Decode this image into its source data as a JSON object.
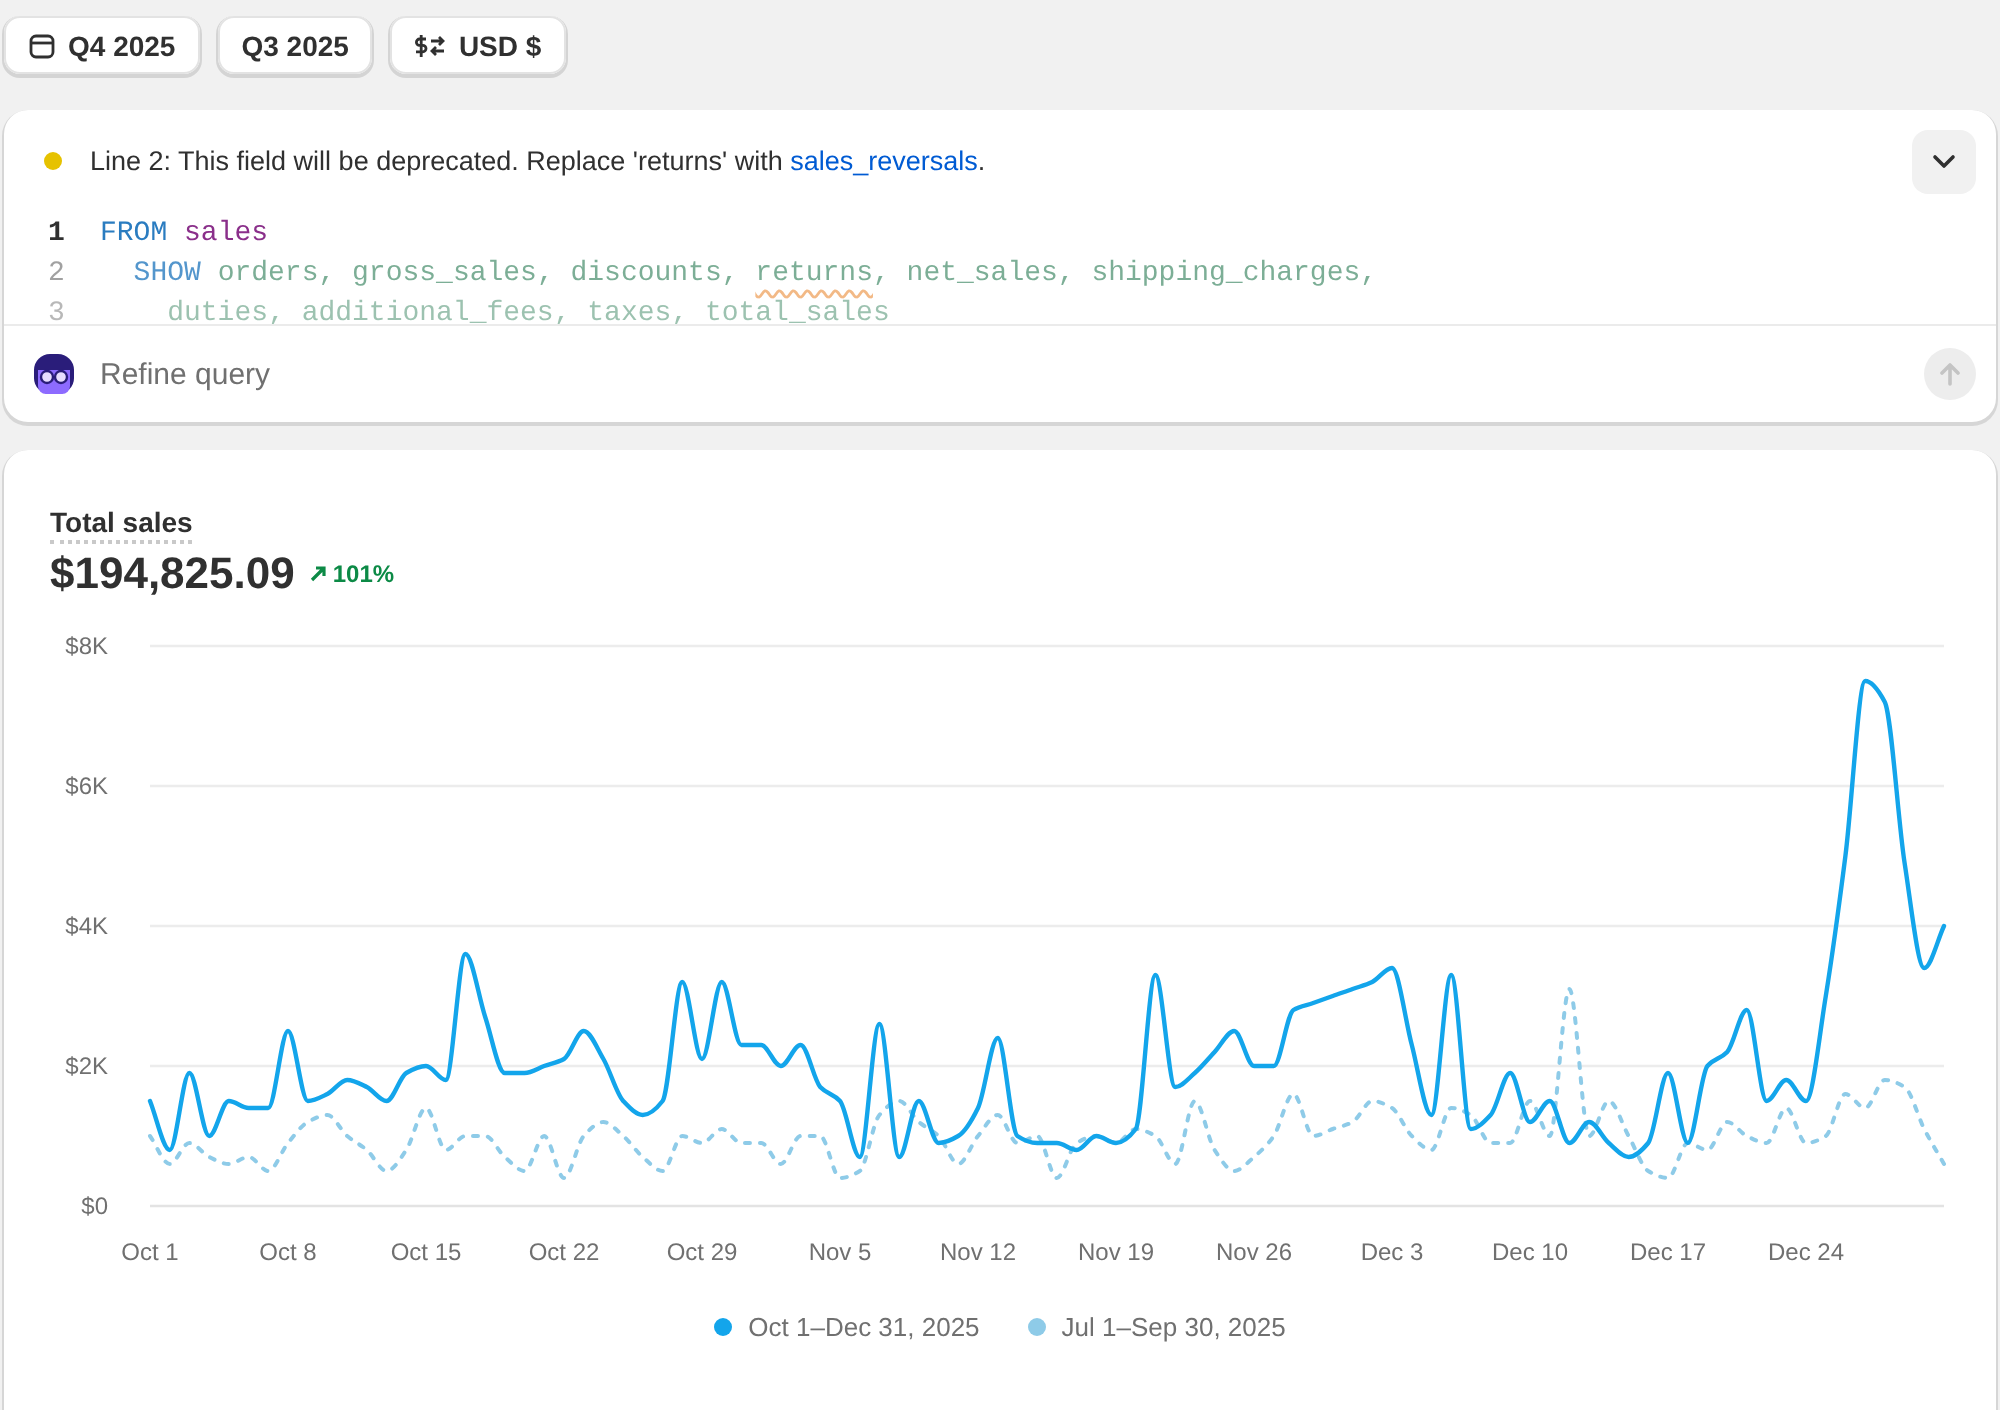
{
  "filters": [
    {
      "label": "Q4 2025",
      "kind": "date_range"
    },
    {
      "label": "Q3 2025",
      "kind": "comparison"
    },
    {
      "label": "USD $",
      "kind": "currency"
    }
  ],
  "query": {
    "warning": {
      "text_before": "Line 2: This field will be deprecated. Replace 'returns' with ",
      "link": "sales_reversals",
      "text_after": "."
    },
    "expanded": false,
    "code": [
      {
        "number": "1",
        "active": true,
        "tokens": [
          {
            "text": "FROM ",
            "kind": "keyword"
          },
          {
            "text": "sales",
            "kind": "source"
          }
        ]
      },
      {
        "number": "2",
        "active": false,
        "tokens": [
          {
            "text": "  SHOW",
            "kind": "keyword"
          },
          {
            "text": " orders, gross_sales, discounts, ",
            "kind": "field"
          },
          {
            "text": "returns",
            "kind": "field",
            "warning": true
          },
          {
            "text": ", net_sales, shipping_charges,",
            "kind": "field"
          }
        ]
      },
      {
        "number": "3",
        "active": false,
        "tokens": [
          {
            "text": "    duties, additional_fees, taxes, total_sales",
            "kind": "field"
          }
        ]
      }
    ],
    "prompt": {
      "placeholder": "Refine query",
      "send_disabled": true
    }
  },
  "report": {
    "title": "Total sales",
    "value": "$194,825.09",
    "change": "101%",
    "chart_data": {
      "type": "line",
      "grid": true,
      "ylim": [
        0,
        8
      ],
      "categories": [
        "Oct 1",
        null,
        null,
        null,
        null,
        null,
        null,
        "Oct 8",
        null,
        null,
        null,
        null,
        null,
        null,
        "Oct 15",
        null,
        null,
        null,
        null,
        null,
        null,
        "Oct 22",
        null,
        null,
        null,
        null,
        null,
        null,
        "Oct 29",
        null,
        null,
        null,
        null,
        null,
        null,
        "Nov 5",
        null,
        null,
        null,
        null,
        null,
        null,
        "Nov 12",
        null,
        null,
        null,
        null,
        null,
        null,
        "Nov 19",
        null,
        null,
        null,
        null,
        null,
        null,
        "Nov 26",
        null,
        null,
        null,
        null,
        null,
        null,
        "Dec 3",
        null,
        null,
        null,
        null,
        null,
        null,
        "Dec 10",
        null,
        null,
        null,
        null,
        null,
        null,
        "Dec 17",
        null,
        null,
        null,
        null,
        null,
        null,
        "Dec 24",
        null,
        null,
        null,
        null,
        null,
        null,
        null
      ],
      "yticks": [
        {
          "value": 0,
          "label": "$0"
        },
        {
          "value": 2,
          "label": "$2K"
        },
        {
          "value": 4,
          "label": "$4K"
        },
        {
          "value": 6,
          "label": "$6K"
        },
        {
          "value": 8,
          "label": "$8K"
        }
      ],
      "series": [
        {
          "name": "Oct 1–Dec 31, 2025",
          "color": "#13a5eb",
          "line_style": "solid",
          "values": [
            1.5,
            0.8,
            1.9,
            1.0,
            1.5,
            1.4,
            1.4,
            2.5,
            1.5,
            1.6,
            1.8,
            1.7,
            1.5,
            1.9,
            2.0,
            1.8,
            3.6,
            2.7,
            1.9,
            1.9,
            2.0,
            2.1,
            2.5,
            2.1,
            1.5,
            1.3,
            1.5,
            3.2,
            2.1,
            3.2,
            2.3,
            2.3,
            2.0,
            2.3,
            1.7,
            1.5,
            0.7,
            2.6,
            0.7,
            1.5,
            0.9,
            1.0,
            1.4,
            2.4,
            1.0,
            0.9,
            0.9,
            0.8,
            1.0,
            0.9,
            1.1,
            3.3,
            1.7,
            1.9,
            2.2,
            2.5,
            2.0,
            2.0,
            2.8,
            2.9,
            3.0,
            3.1,
            3.2,
            3.4,
            2.3,
            1.3,
            3.3,
            1.1,
            1.3,
            1.9,
            1.2,
            1.5,
            0.9,
            1.2,
            0.9,
            0.7,
            0.9,
            1.9,
            0.9,
            2.0,
            2.2,
            2.8,
            1.5,
            1.8,
            1.5,
            3.0,
            5.0,
            7.5,
            7.2,
            4.9,
            3.4,
            4.0
          ]
        },
        {
          "name": "Jul 1–Sep 30, 2025",
          "color": "#8ecbe8",
          "line_style": "dotted",
          "values": [
            1.0,
            0.6,
            0.9,
            0.7,
            0.6,
            0.7,
            0.5,
            0.9,
            1.2,
            1.3,
            1.0,
            0.8,
            0.5,
            0.8,
            1.4,
            0.8,
            1.0,
            1.0,
            0.7,
            0.5,
            1.0,
            0.4,
            1.0,
            1.2,
            1.0,
            0.7,
            0.5,
            1.0,
            0.9,
            1.1,
            0.9,
            0.9,
            0.6,
            1.0,
            1.0,
            0.4,
            0.5,
            1.3,
            1.5,
            1.2,
            1.0,
            0.6,
            1.0,
            1.3,
            0.9,
            1.0,
            0.4,
            0.9,
            1.0,
            0.9,
            1.1,
            1.0,
            0.6,
            1.5,
            0.8,
            0.5,
            0.7,
            1.0,
            1.6,
            1.0,
            1.1,
            1.2,
            1.5,
            1.4,
            1.0,
            0.8,
            1.4,
            1.3,
            0.9,
            0.9,
            1.5,
            1.0,
            3.1,
            1.0,
            1.5,
            1.0,
            0.5,
            0.4,
            0.9,
            0.8,
            1.2,
            1.0,
            0.9,
            1.4,
            0.9,
            1.0,
            1.6,
            1.4,
            1.8,
            1.7,
            1.1,
            0.6
          ]
        }
      ]
    }
  }
}
